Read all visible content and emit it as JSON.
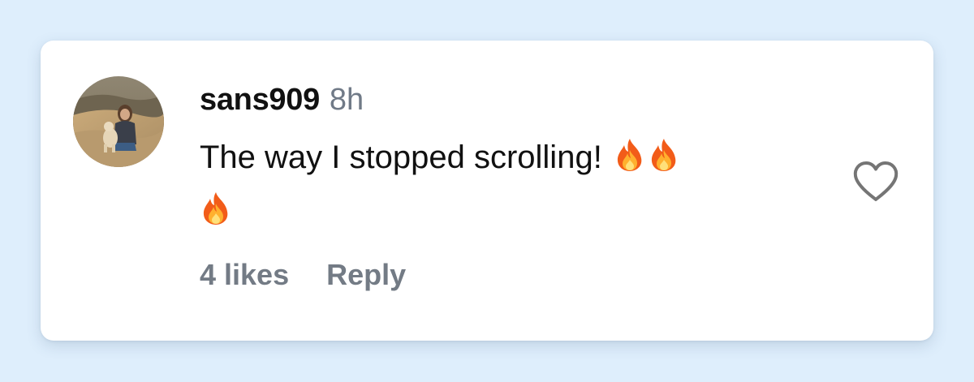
{
  "comment": {
    "username": "sans909",
    "timestamp": "8h",
    "text": "The way I stopped scrolling!",
    "emojis": [
      "fire",
      "fire",
      "fire"
    ],
    "likes_label": "4 likes",
    "reply_label": "Reply"
  },
  "colors": {
    "page_background": "#deeefc",
    "card_background": "#ffffff",
    "primary_text": "#111111",
    "secondary_text": "#737b85",
    "heart_outline": "#757575"
  }
}
